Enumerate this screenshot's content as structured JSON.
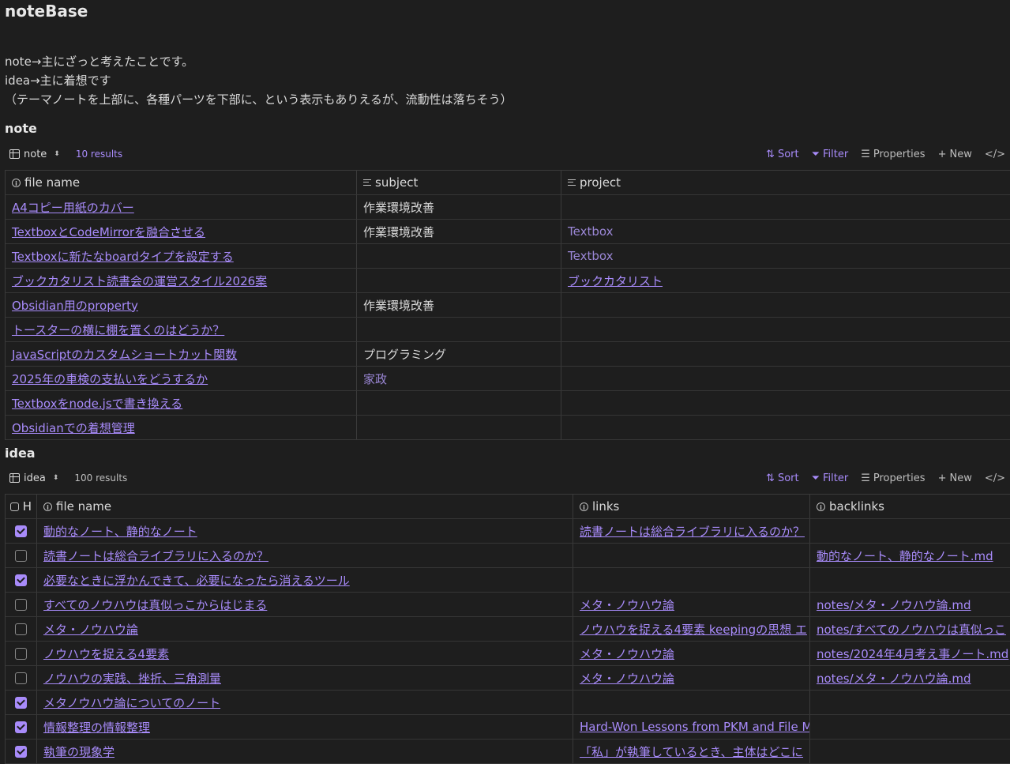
{
  "page": {
    "title": "noteBase",
    "description": [
      "note→主にざっと考えたことです。",
      "idea→主に着想です",
      "（テーマノートを上部に、各種パーツを下部に、という表示もありえるが、流動性は落ちそう）"
    ]
  },
  "toolbar_labels": {
    "sort": "Sort",
    "filter": "Filter",
    "properties": "Properties",
    "new": "New",
    "code": "</>"
  },
  "note": {
    "heading": "note",
    "view_name": "note",
    "results": "10 results",
    "columns": [
      "file name",
      "subject",
      "project"
    ],
    "rows": [
      {
        "file": "A4コピー用紙のカバー",
        "subject": "作業環境改善",
        "project": ""
      },
      {
        "file": "TextboxとCodeMirrorを融合させる",
        "subject": "作業環境改善",
        "project": "Textbox"
      },
      {
        "file": "Textboxに新たなboardタイプを設定する",
        "subject": "",
        "project": "Textbox"
      },
      {
        "file": "ブックカタリスト読書会の運営スタイル2026案",
        "subject": "",
        "project": "ブックカタリスト"
      },
      {
        "file": "Obsidian用のproperty",
        "subject": "作業環境改善",
        "project": ""
      },
      {
        "file": "トースターの横に棚を置くのはどうか？",
        "subject": "",
        "project": ""
      },
      {
        "file": "JavaScriptのカスタムショートカット関数",
        "subject": "プログラミング",
        "project": ""
      },
      {
        "file": "2025年の車検の支払いをどうするか",
        "subject": "家政",
        "project": ""
      },
      {
        "file": "Textboxをnode.jsで書き換える",
        "subject": "",
        "project": ""
      },
      {
        "file": "Obsidianでの着想管理",
        "subject": "",
        "project": ""
      }
    ]
  },
  "idea": {
    "heading": "idea",
    "view_name": "idea",
    "results": "100 results",
    "columns": [
      "H",
      "file name",
      "links",
      "backlinks"
    ],
    "rows": [
      {
        "checked": true,
        "file": "動的なノート、静的なノート",
        "links": "読書ノートは総合ライブラリに入るのか？",
        "backlinks": ""
      },
      {
        "checked": false,
        "file": "読書ノートは総合ライブラリに入るのか？",
        "links": "",
        "backlinks": "動的なノート、静的なノート.md"
      },
      {
        "checked": true,
        "file": "必要なときに浮かんできて、必要になったら消えるツール",
        "links": "",
        "backlinks": ""
      },
      {
        "checked": false,
        "file": "すべてのノウハウは真似っこからはじまる",
        "links": "メタ・ノウハウ論",
        "backlinks": "notes/メタ・ノウハウ論.md"
      },
      {
        "checked": false,
        "file": "メタ・ノウハウ論",
        "links": "ノウハウを捉える4要素 keepingの思想 エ",
        "backlinks": "notes/すべてのノウハウは真似っこ"
      },
      {
        "checked": false,
        "file": "ノウハウを捉える4要素",
        "links": "メタ・ノウハウ論",
        "backlinks": "notes/2024年4月考え事ノート.md"
      },
      {
        "checked": false,
        "file": "ノウハウの実践、挫折、三角測量",
        "links": "メタ・ノウハウ論",
        "backlinks": "notes/メタ・ノウハウ論.md"
      },
      {
        "checked": true,
        "file": "メタノウハウ論についてのノート",
        "links": "",
        "backlinks": ""
      },
      {
        "checked": true,
        "file": "情報整理の情報整理",
        "links": "Hard-Won Lessons from PKM and File Ma",
        "backlinks": ""
      },
      {
        "checked": true,
        "file": "執筆の現象学",
        "links": "「私」が執筆しているとき、主体はどこに",
        "backlinks": ""
      }
    ]
  },
  "colors": {
    "accent": "#a88bfa",
    "background": "#1e1e1e",
    "text": "#dadada"
  }
}
